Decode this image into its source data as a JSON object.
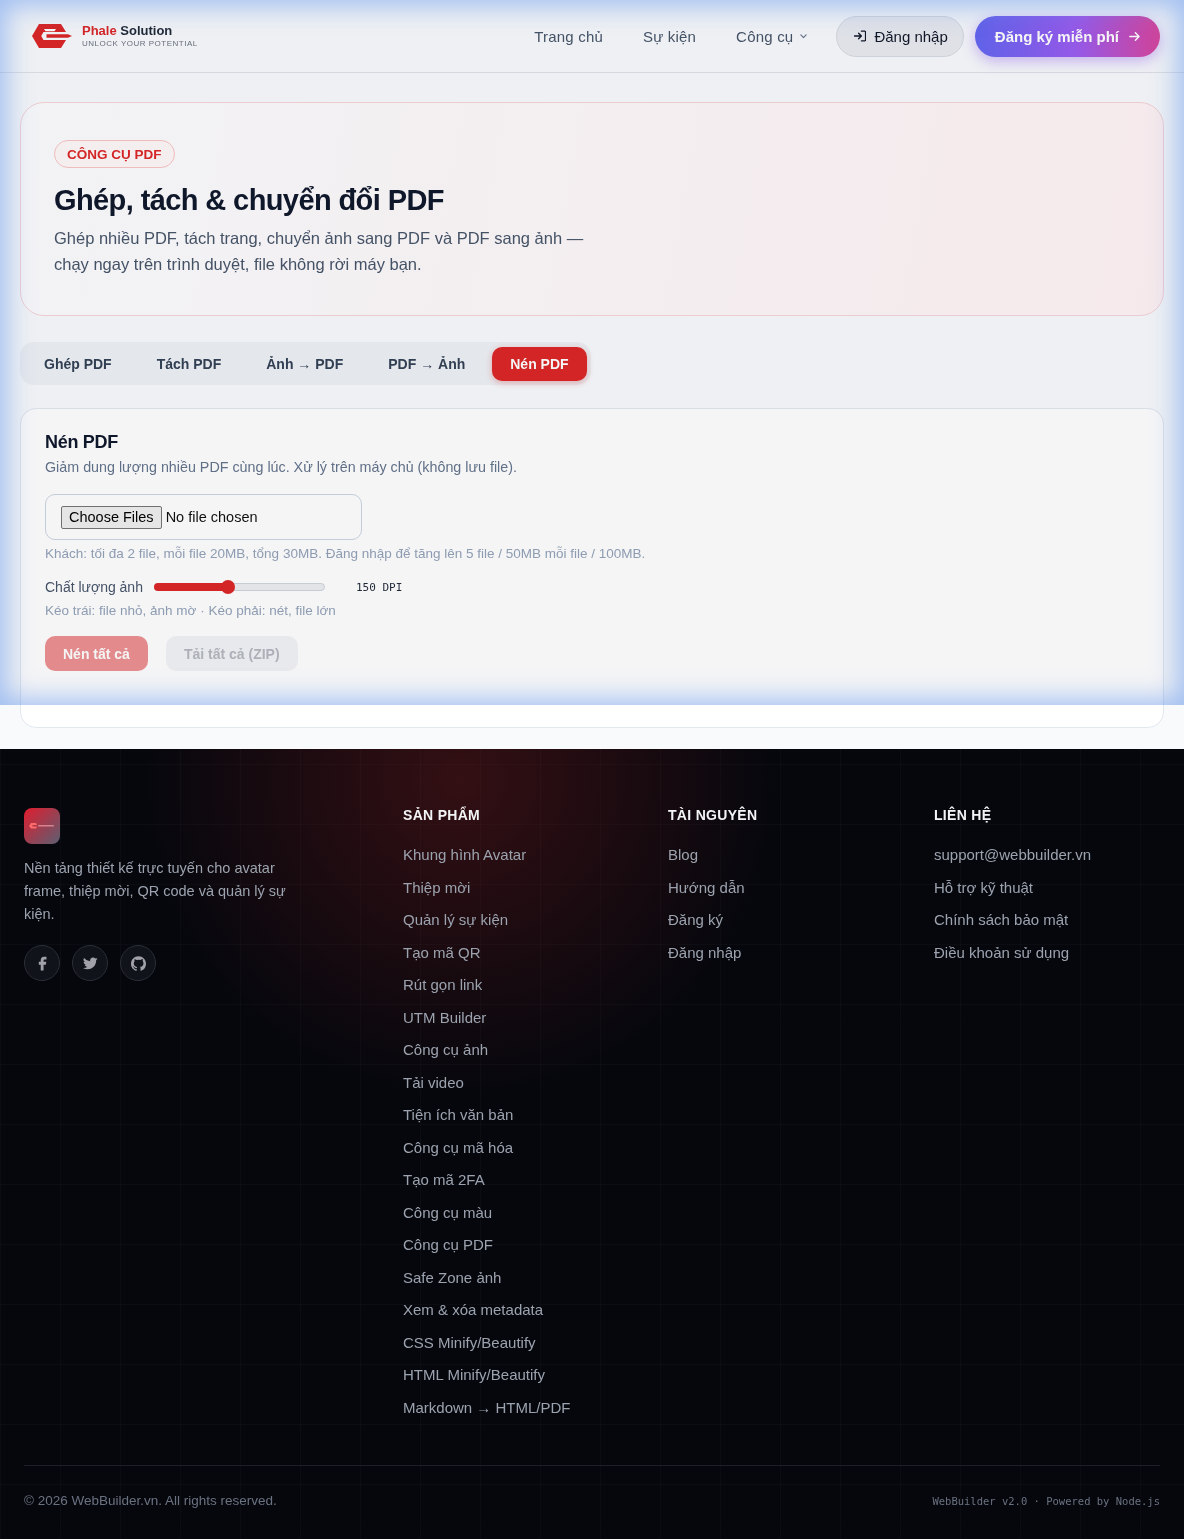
{
  "header": {
    "brand": {
      "name_parts": [
        "Phale",
        "Solution"
      ],
      "tagline": "UNLOCK YOUR POTENTIAL"
    },
    "nav": [
      {
        "label": "Trang chủ",
        "kind": "link"
      },
      {
        "label": "Sự kiện",
        "kind": "link"
      },
      {
        "label": "Công cụ",
        "kind": "dropdown"
      }
    ],
    "login_button": {
      "label": "Đăng nhập"
    },
    "signup_button": {
      "label": "Đăng ký miễn phí"
    }
  },
  "hero": {
    "badge": "CÔNG CỤ PDF",
    "title": "Ghép, tách & chuyển đổi PDF",
    "description": "Ghép nhiều PDF, tách trang, chuyển ảnh sang PDF và PDF sang ảnh — chạy ngay trên trình duyệt, file không rời máy bạn."
  },
  "tabs": [
    {
      "label": "Ghép PDF",
      "selected": false
    },
    {
      "label": "Tách PDF",
      "selected": false
    },
    {
      "label": "Ảnh → PDF",
      "selected": false
    },
    {
      "label": "PDF → Ảnh",
      "selected": false
    },
    {
      "label": "Nén PDF",
      "selected": true
    }
  ],
  "panel": {
    "title": "Nén PDF",
    "description": "Giảm dung lượng nhiều PDF cùng lúc. Xử lý trên máy chủ (không lưu file).",
    "file_input": {
      "button": "Choose Files",
      "status": "No file chosen"
    },
    "limits_hint": "Khách: tối đa 2 file, mỗi file 20MB, tổng 30MB. Đăng nhập để tăng lên 5 file / 50MB mỗi file / 100MB.",
    "quality": {
      "label": "Chất lượng ảnh",
      "level": 0.43,
      "reading": "150 DPI",
      "hint": "Kéo trái: file nhỏ, ảnh mờ · Kéo phải: nét, file lớn"
    },
    "buttons": [
      {
        "label": "Nén tất cả",
        "kind": "primary",
        "disabled": true
      },
      {
        "label": "Tải tất cả (ZIP)",
        "kind": "secondary",
        "disabled": true
      }
    ]
  },
  "footer": {
    "description": "Nền tảng thiết kế trực tuyến cho avatar frame, thiệp mời, QR code và quản lý sự kiện.",
    "socials": [
      {
        "kind": "facebook"
      },
      {
        "kind": "twitter"
      },
      {
        "kind": "github"
      }
    ],
    "columns": [
      {
        "heading": "SẢN PHẨM",
        "links": [
          "Khung hình Avatar",
          "Thiệp mời",
          "Quản lý sự kiện",
          "Tạo mã QR",
          "Rút gọn link",
          "UTM Builder",
          "Công cụ ảnh",
          "Tải video",
          "Tiện ích văn bản",
          "Công cụ mã hóa",
          "Tạo mã 2FA",
          "Công cụ màu",
          "Công cụ PDF",
          "Safe Zone ảnh",
          "Xem & xóa metadata",
          "CSS Minify/Beautify",
          "HTML Minify/Beautify",
          "Markdown → HTML/PDF"
        ]
      },
      {
        "heading": "TÀI NGUYÊN",
        "links": [
          "Blog",
          "Hướng dẫn",
          "Đăng ký",
          "Đăng nhập"
        ]
      },
      {
        "heading": "LIÊN HỆ",
        "links": [
          "support@webbuilder.vn",
          "Hỗ trợ kỹ thuật",
          "Chính sách bảo mật",
          "Điều khoản sử dụng"
        ]
      }
    ],
    "copyright": "© 2026 WebBuilder.vn. All rights reserved.",
    "meta": "WebBuilder v2.0 · Powered by Node.js"
  }
}
